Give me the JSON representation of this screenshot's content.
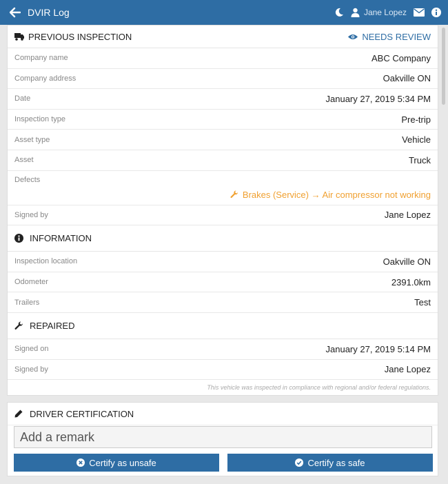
{
  "app": {
    "title": "DVIR Log",
    "user_name": "Jane Lopez"
  },
  "colors": {
    "primary": "#2e6da4",
    "defect": "#f0a030",
    "label_gray": "#888888"
  },
  "icons": [
    "arrow-left-icon",
    "moon-icon",
    "user-icon",
    "envelope-icon",
    "info-icon",
    "truck-icon",
    "eye-icon",
    "wrench-icon",
    "pencil-icon",
    "times-circle-icon",
    "check-circle-icon"
  ],
  "previous": {
    "header": "PREVIOUS INSPECTION",
    "status": "NEEDS REVIEW",
    "rows": [
      {
        "label": "Company name",
        "value": "ABC Company"
      },
      {
        "label": "Company address",
        "value": "Oakville ON"
      },
      {
        "label": "Date",
        "value": "January 27, 2019 5:34 PM"
      },
      {
        "label": "Inspection type",
        "value": "Pre-trip"
      },
      {
        "label": "Asset type",
        "value": "Vehicle"
      },
      {
        "label": "Asset",
        "value": "Truck"
      }
    ],
    "defects_label": "Defects",
    "defect_text": "Brakes (Service) → Air compressor not working",
    "signed_by_label": "Signed by",
    "signed_by_value": "Jane Lopez"
  },
  "information": {
    "header": "INFORMATION",
    "rows": [
      {
        "label": "Inspection location",
        "value": "Oakville ON"
      },
      {
        "label": "Odometer",
        "value": "2391.0km"
      },
      {
        "label": "Trailers",
        "value": "Test"
      }
    ]
  },
  "repaired": {
    "header": "REPAIRED",
    "rows": [
      {
        "label": "Signed on",
        "value": "January 27, 2019 5:14 PM"
      },
      {
        "label": "Signed by",
        "value": "Jane Lopez"
      }
    ]
  },
  "compliance_note": "This vehicle was inspected in compliance with regional and/or federal regulations.",
  "certification": {
    "header": "DRIVER CERTIFICATION",
    "remark_placeholder": "Add a remark",
    "unsafe_label": "Certify as unsafe",
    "safe_label": "Certify as safe"
  }
}
